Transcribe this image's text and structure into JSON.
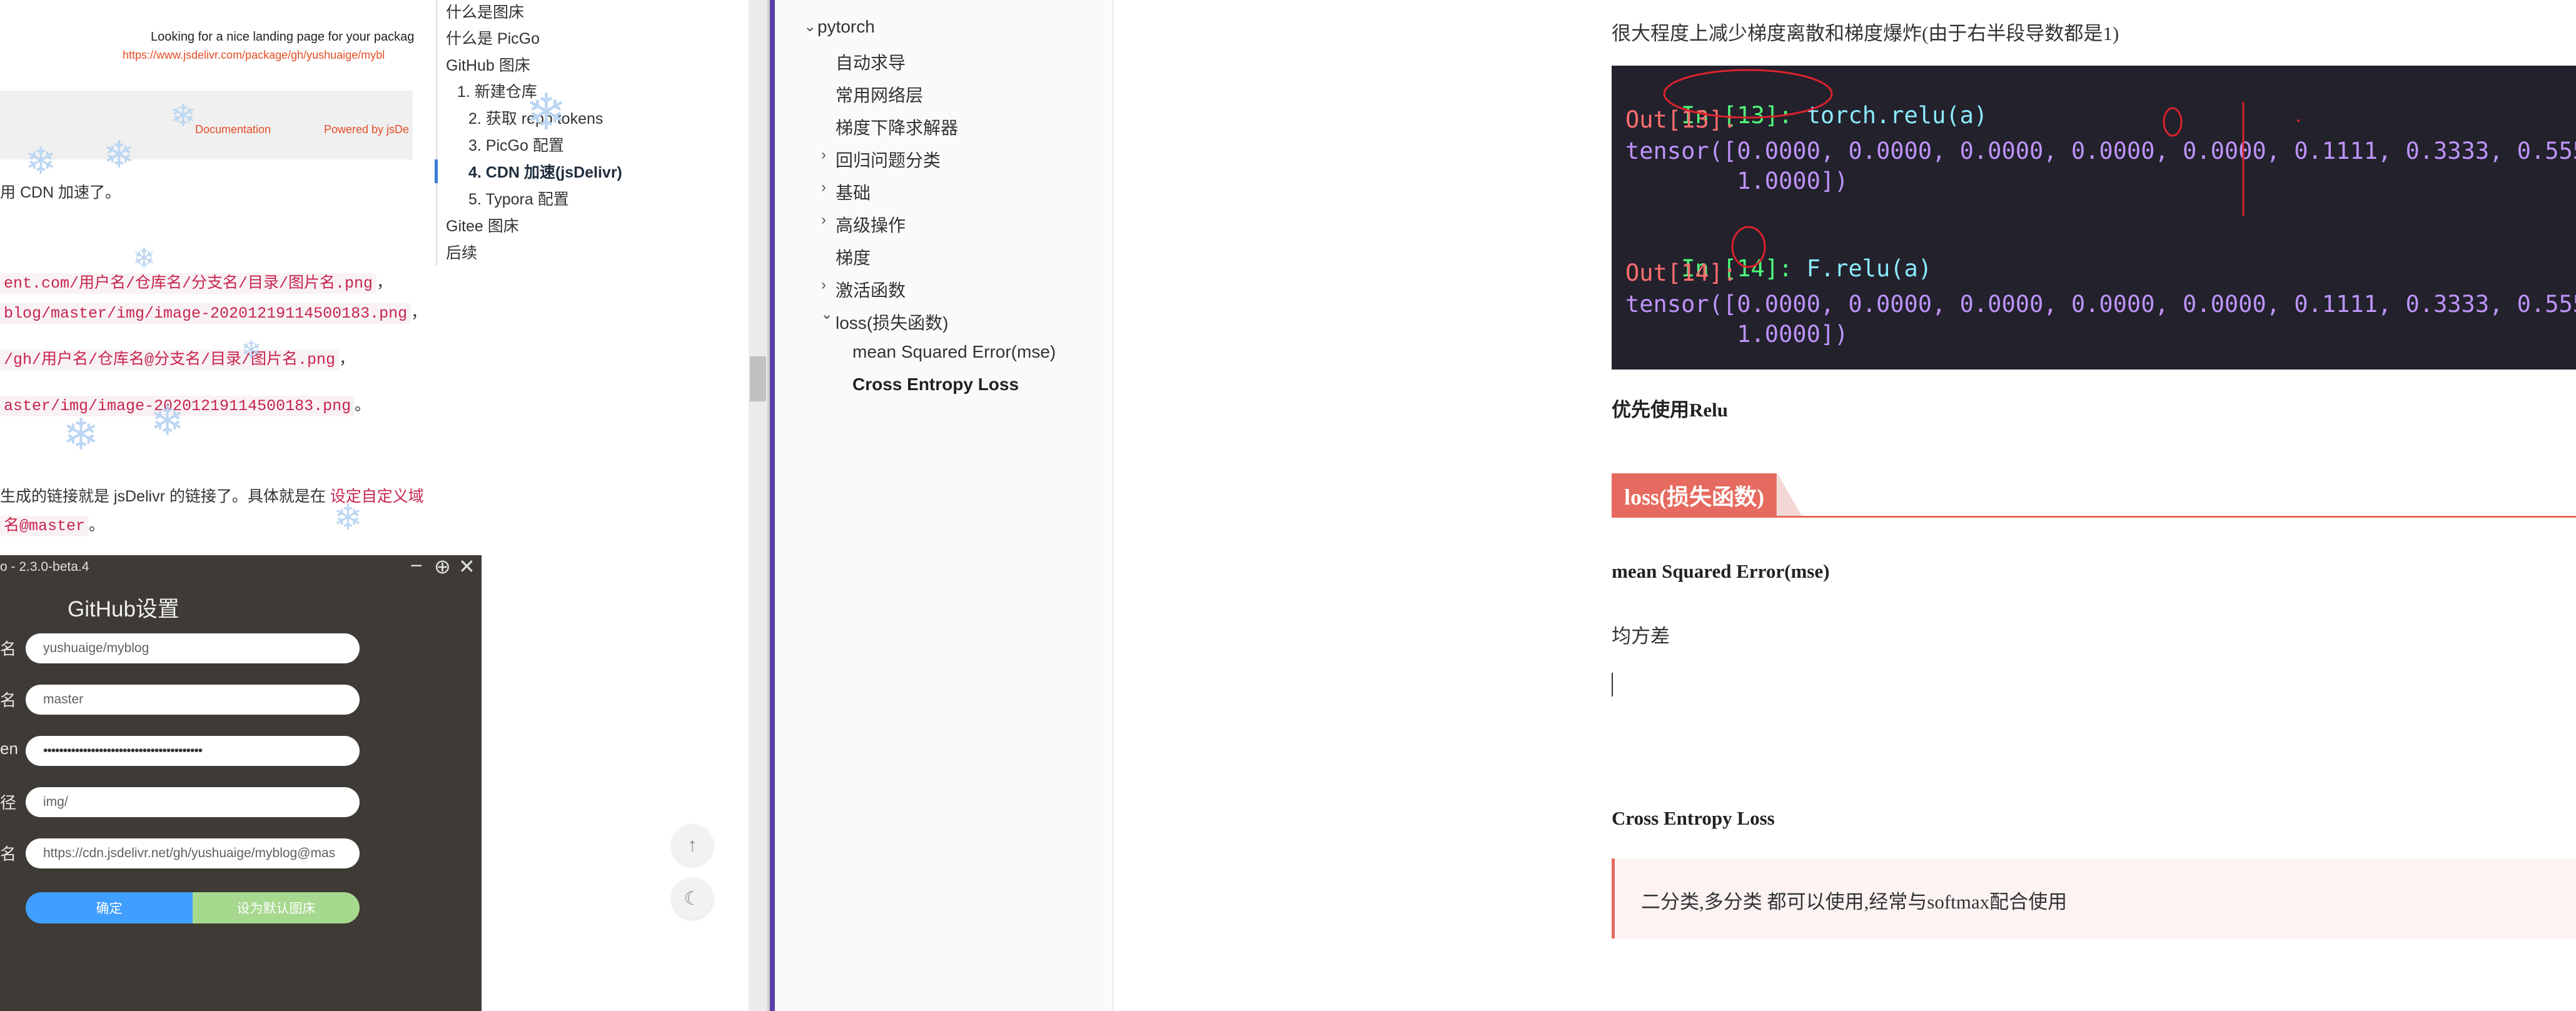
{
  "left_page": {
    "top_line1": "Looking for a nice landing page for your packag",
    "top_line2": "https://www.jsdelivr.com/package/gh/yushuaige/mybl",
    "footer_doc": "Documentation",
    "footer_powered": "Powered by jsDe",
    "cdn_text": "用 CDN 加速了。",
    "code1": "ent.com/用户名/仓库名/分支名/目录/图片名.png",
    "code1_tail": "，",
    "code2": "blog/master/img/image-20201219114500183.png",
    "code2_tail": "，",
    "code3": "/gh/用户名/仓库名@分支名/目录/图片名.png",
    "code3_tail": "，",
    "code4": "aster/img/image-20201219114500183.png",
    "code4_tail": "。",
    "para1": "生成的链接就是 jsDelivr 的链接了。具体就是在",
    "para1_link": "设定自定义域",
    "para2_code": "名@master",
    "para2_tail": "。"
  },
  "toc": {
    "items": [
      {
        "label": "什么是图床"
      },
      {
        "label": "什么是 PicGo"
      },
      {
        "label": "GitHub 图床"
      },
      {
        "label": "1. 新建仓库"
      },
      {
        "label": "2. 获取 repo tokens"
      },
      {
        "label": "3. PicGo 配置"
      },
      {
        "label": "4. CDN 加速(jsDelivr)"
      },
      {
        "label": "5. Typora 配置"
      },
      {
        "label": "Gitee 图床"
      },
      {
        "label": "后续"
      }
    ]
  },
  "picgo": {
    "window_title": "o - 2.3.0-beta.4",
    "heading": "GitHub设置",
    "label_repo": "名",
    "label_branch": "名",
    "label_token": "en",
    "label_path": "径",
    "label_domain": "名",
    "repo_value": "yushuaige/myblog",
    "branch_value": "master",
    "token_value": "••••••••••••••••••••••••••••••••••••••••",
    "path_value": "img/",
    "domain_value": "https://cdn.jsdelivr.net/gh/yushuaige/myblog@mas",
    "confirm_label": "确定",
    "default_label": "设为默认图床"
  },
  "outline": {
    "root": "pytorch",
    "items": [
      {
        "label": "自动求导"
      },
      {
        "label": "常用网络层"
      },
      {
        "label": "梯度下降求解器"
      },
      {
        "label": "回归问题分类"
      },
      {
        "label": "基础"
      },
      {
        "label": "高级操作"
      },
      {
        "label": "梯度"
      },
      {
        "label": "激活函数"
      },
      {
        "label": "loss(损失函数)"
      },
      {
        "label": "mean Squared Error(mse)"
      },
      {
        "label": "Cross Entropy Loss"
      }
    ]
  },
  "doc": {
    "intro": "很大程度上减少梯度离散和梯度爆炸(由于右半段导数都是1)",
    "code": {
      "in13": "In [13]:",
      "in13_code": "torch.relu(a)",
      "out13": "Out[13]:",
      "t1a": "tensor([0.0000, 0.0000, 0.0000, 0.0000, 0.0000, 0.1111, 0.3333, 0.5556, 0",
      "t1b": "        1.0000])",
      "in14": "In [14]:",
      "in14_code": "F.relu(a)",
      "out14": "Out[14]:",
      "t2a": "tensor([0.0000, 0.0000, 0.0000, 0.0000, 0.0000, 0.1111, 0.3333, 0.5556, 0",
      "t2b": "        1.0000])"
    },
    "prefer_relu": "优先使用Relu",
    "h2_loss": "loss(损失函数)",
    "h3_mse": "mean Squared Error(mse)",
    "mse_desc": "均方差",
    "h3_ce": "Cross Entropy Loss",
    "quote": "二分类,多分类 都可以使用,经常与softmax配合使用"
  },
  "colors": {
    "accent": "#e66a5f",
    "sidebar_accent": "#5a3fa8",
    "picgo_confirm": "#409eff",
    "picgo_default": "#a6d88e"
  }
}
